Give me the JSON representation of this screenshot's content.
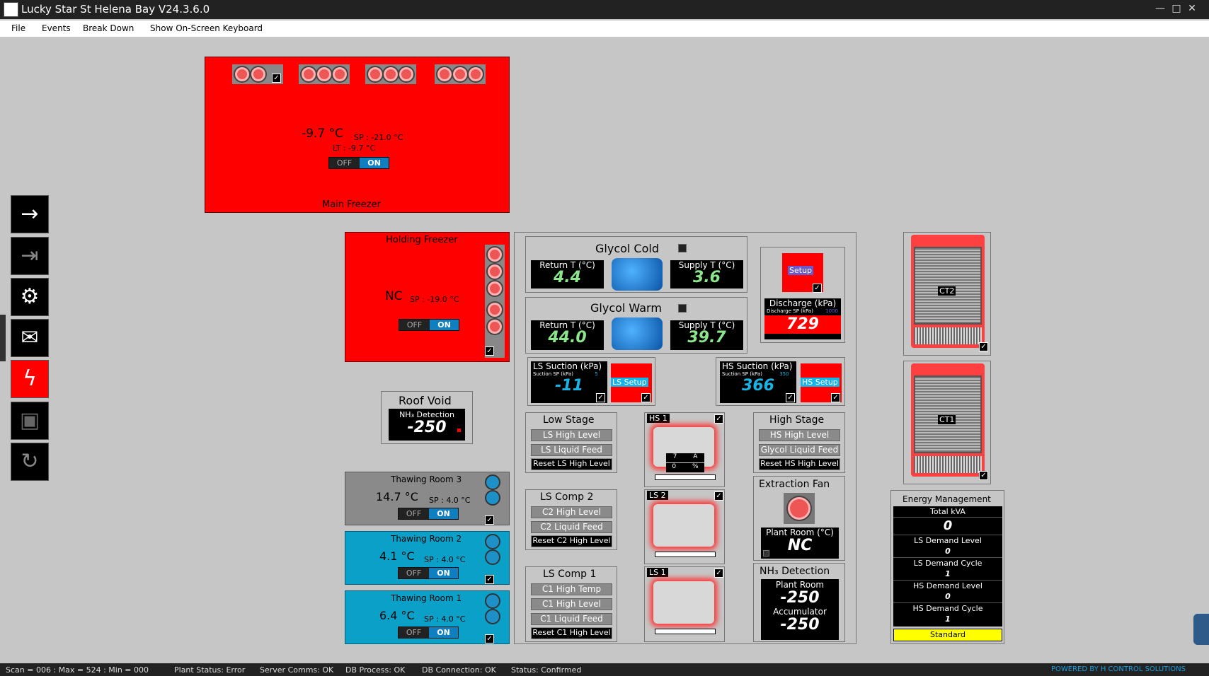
{
  "window": {
    "title": "Lucky Star St Helena Bay V24.3.6.0",
    "min": "—",
    "max": "□",
    "close": "✕"
  },
  "menu": [
    "File",
    "Events",
    "Break Down",
    "Show On-Screen Keyboard"
  ],
  "main_freezer": {
    "temp": "-9.7 °C",
    "sp": "SP : -21.0 °C",
    "lt": "LT : -9.7 °C",
    "off": "OFF",
    "on": "ON",
    "name": "Main Freezer"
  },
  "holding_freezer": {
    "name": "Holding Freezer",
    "temp": "NC",
    "sp": "SP : -19.0 °C",
    "off": "OFF",
    "on": "ON"
  },
  "roof_void": {
    "title": "Roof Void",
    "label": "NH₃ Detection",
    "value": "-250"
  },
  "thawing": [
    {
      "name": "Thawing Room 3",
      "temp": "14.7 °C",
      "sp": "SP : 4.0 °C",
      "off": "OFF",
      "on": "ON"
    },
    {
      "name": "Thawing Room 2",
      "temp": "4.1 °C",
      "sp": "SP : 4.0 °C",
      "off": "OFF",
      "on": "ON"
    },
    {
      "name": "Thawing Room 1",
      "temp": "6.4 °C",
      "sp": "SP : 4.0 °C",
      "off": "OFF",
      "on": "ON"
    }
  ],
  "glycol_cold": {
    "title": "Glycol Cold",
    "return_label": "Return T (°C)",
    "return": "4.4",
    "supply_label": "Supply T (°C)",
    "supply": "3.6"
  },
  "glycol_warm": {
    "title": "Glycol Warm",
    "return_label": "Return T (°C)",
    "return": "44.0",
    "supply_label": "Supply T (°C)",
    "supply": "39.7"
  },
  "discharge": {
    "setup": "Setup",
    "label": "Discharge (kPa)",
    "sp_label": "Discharge SP (kPa)",
    "sp": "1000",
    "value": "729"
  },
  "ls_suction": {
    "label": "LS Suction (kPa)",
    "sp_label": "Suction SP (kPa)",
    "sp": "5",
    "value": "-11",
    "setup": "LS Setup"
  },
  "hs_suction": {
    "label": "HS Suction (kPa)",
    "sp_label": "Suction SP (kPa)",
    "sp": "350",
    "value": "366",
    "setup": "HS Setup"
  },
  "low_stage": {
    "title": "Low Stage",
    "b1": "LS High Level",
    "b2": "LS Liquid Feed",
    "b3": "Reset LS High Level"
  },
  "ls_comp2": {
    "title": "LS Comp 2",
    "b1": "C2 High Level",
    "b2": "C2 Liquid Feed",
    "b3": "Reset C2 High Level"
  },
  "ls_comp1": {
    "title": "LS Comp 1",
    "b1": "C1 High Temp",
    "b2": "C1 High Level",
    "b3": "C1 Liquid Feed",
    "b4": "Reset C1 High Level"
  },
  "compressors": {
    "hs1": "HS 1",
    "hs1_amps": "7",
    "hs1_amp_unit": "A",
    "hs1_pct": "0",
    "hs1_pct_unit": "%",
    "ls2": "LS 2",
    "ls1": "LS 1"
  },
  "high_stage": {
    "title": "High Stage",
    "b1": "HS High Level",
    "b2": "Glycol Liquid Feed",
    "b3": "Reset HS High Level"
  },
  "extraction_fan": {
    "title": "Extraction Fan",
    "label": "Plant Room (°C)",
    "value": "NC"
  },
  "nh3": {
    "title": "NH₃ Detection",
    "plant_label": "Plant Room",
    "plant": "-250",
    "acc_label": "Accumulator",
    "acc": "-250"
  },
  "cooling_towers": {
    "ct2": "CT2",
    "ct1": "CT1"
  },
  "energy": {
    "title": "Energy Management",
    "total_label": "Total kVA",
    "total": "0",
    "ls_level_label": "LS Demand Level",
    "ls_level": "0",
    "ls_cycle_label": "LS Demand Cycle",
    "ls_cycle": "1",
    "hs_level_label": "HS Demand Level",
    "hs_level": "0",
    "hs_cycle_label": "HS Demand Cycle",
    "hs_cycle": "1",
    "mode": "Standard"
  },
  "status": {
    "scan": "Scan = 006 : Max = 524 : Min = 000",
    "plant": "Plant Status: Error",
    "server": "Server Comms: OK",
    "dbp": "DB Process:  OK",
    "dbc": "DB Connection:  OK",
    "st": "Status:  Confirmed",
    "powered": "POWERED BY H CONTROL SOLUTIONS"
  },
  "icons": {
    "login": "→",
    "logout": "⇥",
    "users": "⚙",
    "mail": "✉",
    "power": "ϟ",
    "save": "▣",
    "refresh": "↻"
  }
}
